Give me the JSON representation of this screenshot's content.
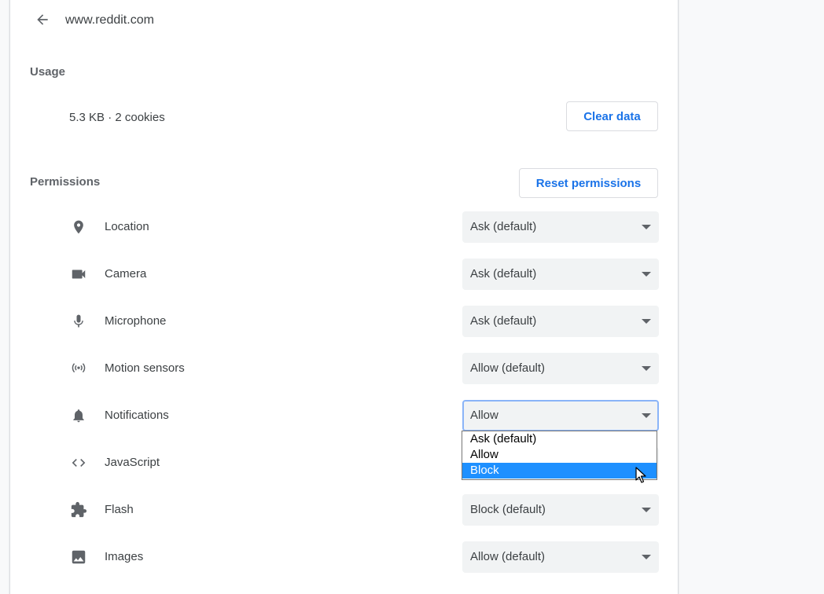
{
  "header": {
    "site": "www.reddit.com",
    "back_icon": "arrow-back-icon"
  },
  "usage": {
    "title": "Usage",
    "summary": "5.3 KB · 2 cookies",
    "clear_button": "Clear data"
  },
  "permissions": {
    "title": "Permissions",
    "reset_button": "Reset permissions",
    "items": [
      {
        "label": "Location",
        "value": "Ask (default)",
        "icon": "location-pin-icon"
      },
      {
        "label": "Camera",
        "value": "Ask (default)",
        "icon": "camera-icon"
      },
      {
        "label": "Microphone",
        "value": "Ask (default)",
        "icon": "microphone-icon"
      },
      {
        "label": "Motion sensors",
        "value": "Allow (default)",
        "icon": "motion-sensors-icon"
      },
      {
        "label": "Notifications",
        "value": "Allow",
        "icon": "bell-icon"
      },
      {
        "label": "JavaScript",
        "value": "",
        "icon": "code-icon"
      },
      {
        "label": "Flash",
        "value": "Block (default)",
        "icon": "puzzle-icon"
      },
      {
        "label": "Images",
        "value": "Allow (default)",
        "icon": "image-icon"
      }
    ]
  },
  "dropdown": {
    "options": [
      "Ask (default)",
      "Allow",
      "Block"
    ],
    "highlighted": "Block"
  },
  "colors": {
    "accent": "#1a73e8",
    "highlight": "#1e90ff",
    "select_bg": "#f1f3f4"
  }
}
